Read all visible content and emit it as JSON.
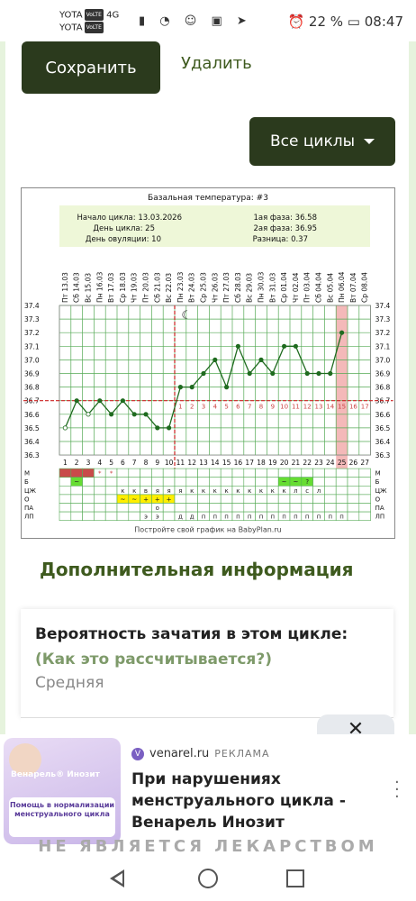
{
  "status": {
    "carrier1": "YOTA",
    "carrier2": "YOTA",
    "volte": "VoLTE",
    "network": "4G",
    "battery": "22 %",
    "time": "08:47"
  },
  "toolbar": {
    "save_label": "Сохранить",
    "delete_label": "Удалить",
    "cycles_label": "Все циклы"
  },
  "chart": {
    "title": "Базальная температура: #3",
    "info": {
      "start": "Начало цикла: 13.03.2026",
      "day": "День цикла: 25",
      "ovulation": "День овуляции: 10",
      "phase1": "1ая фаза: 36.58",
      "phase2": "2ая фаза: 36.95",
      "diff": "Разница: 0.37"
    },
    "footer": "Постройте свой график на BabyPlan.ru",
    "row_labels": [
      "М",
      "Б",
      "ЦЖ",
      "О",
      "ПА",
      "ЛП"
    ]
  },
  "chart_data": {
    "type": "line",
    "title": "Базальная температура: #3",
    "x": [
      1,
      2,
      3,
      4,
      5,
      6,
      7,
      8,
      9,
      10,
      11,
      12,
      13,
      14,
      15,
      16,
      17,
      18,
      19,
      20,
      21,
      22,
      23,
      24,
      25
    ],
    "dates": [
      "13.03",
      "14.03",
      "15.03",
      "16.03",
      "17.03",
      "18.03",
      "19.03",
      "20.03",
      "21.03",
      "22.03",
      "23.03",
      "24.03",
      "25.03",
      "26.03",
      "27.03",
      "28.03",
      "29.03",
      "30.03",
      "31.03",
      "01.04",
      "02.04",
      "03.04",
      "04.04",
      "05.04",
      "06.04",
      "07.04",
      "08.04"
    ],
    "weekdays": [
      "Пт",
      "Сб",
      "Вс",
      "Пн",
      "Вт",
      "Ср",
      "Чт",
      "Пт",
      "Сб",
      "Вс",
      "Пн",
      "Вт",
      "Ср",
      "Чт",
      "Пт",
      "Сб",
      "Вс",
      "Пн",
      "Вт",
      "Ср",
      "Чт",
      "Пт",
      "Сб",
      "Вс",
      "Пн",
      "Вт",
      "Ср"
    ],
    "day_numbers": [
      "1",
      "2",
      "3",
      "4",
      "5",
      "6",
      "7",
      "8",
      "9",
      "10",
      "11",
      "12",
      "13",
      "14",
      "15",
      "16",
      "17",
      "18",
      "19",
      "20",
      "21",
      "22",
      "23",
      "24",
      "25",
      "26",
      "27"
    ],
    "temperatures": [
      36.5,
      36.7,
      36.6,
      36.7,
      36.6,
      36.7,
      36.6,
      36.6,
      36.5,
      36.5,
      36.8,
      36.8,
      36.9,
      37.0,
      36.8,
      37.1,
      36.9,
      37.0,
      36.9,
      37.1,
      37.1,
      36.9,
      36.9,
      36.9,
      37.2
    ],
    "ylim": [
      36.3,
      37.4
    ],
    "yticks": [
      "37.4",
      "37.3",
      "37.2",
      "37.1",
      "37.0",
      "36.9",
      "36.8",
      "36.7",
      "36.6",
      "36.5",
      "36.4",
      "36.3"
    ],
    "coverline": 36.7,
    "ovulation_day": 10,
    "luteal_numbers": [
      "1",
      "2",
      "3",
      "4",
      "5",
      "6",
      "7",
      "8",
      "9",
      "10",
      "11",
      "12",
      "13",
      "14",
      "15",
      "16",
      "17"
    ],
    "highlight_day": 25,
    "moon_day": 11,
    "rows": {
      "M": [
        "",
        "",
        "",
        "*",
        "*"
      ],
      "B": [
        "",
        "~",
        "",
        "",
        "",
        "",
        "",
        "",
        "",
        "",
        "",
        "",
        "",
        "",
        "",
        "",
        "",
        "",
        "",
        "~",
        "~",
        "?"
      ],
      "CZH": [
        "",
        "",
        "",
        "",
        "",
        "к",
        "к",
        "в",
        "я",
        "я",
        "я",
        "к",
        "к",
        "к",
        "к",
        "к",
        "к",
        "к",
        "к",
        "к",
        "л",
        "с",
        "л"
      ],
      "O": [
        "",
        "",
        "",
        "",
        "",
        "~",
        "~",
        "+",
        "+",
        "+"
      ],
      "PA": [
        "",
        "",
        "",
        "",
        "",
        "",
        "",
        "",
        "o"
      ],
      "LP": [
        "",
        "",
        "",
        "",
        "",
        "",
        "",
        "э",
        "э",
        "",
        "д",
        "д",
        "п",
        "п",
        "п",
        "п",
        "п",
        "п",
        "п",
        "п",
        "п",
        "п",
        "п",
        "п",
        "п"
      ]
    },
    "colors": {
      "line": "#1f6b1f",
      "coverline": "#c22",
      "highlight": "#f4b9b9",
      "menses": "#c94a4a",
      "green_cell": "#66dd33",
      "yellow_cell": "#ffee00"
    }
  },
  "info_section": {
    "title": "Дополнительная информация",
    "question": "Вероятность зачатия в этом цикле:",
    "link": "(Как это рассчитывается?)",
    "answer": "Средняя"
  },
  "ad": {
    "source": "venarel.ru",
    "tag": "РЕКЛАМА",
    "text": "При нарушениях менструального цикла - Венарель Инозит",
    "image_brand": "Венарель® Инозит",
    "image_tagline": "Помощь в нормализации менструального цикла",
    "banner": "НЕ ЯВЛЯЕТСЯ ЛЕКАРСТВОМ",
    "close": "✕"
  }
}
